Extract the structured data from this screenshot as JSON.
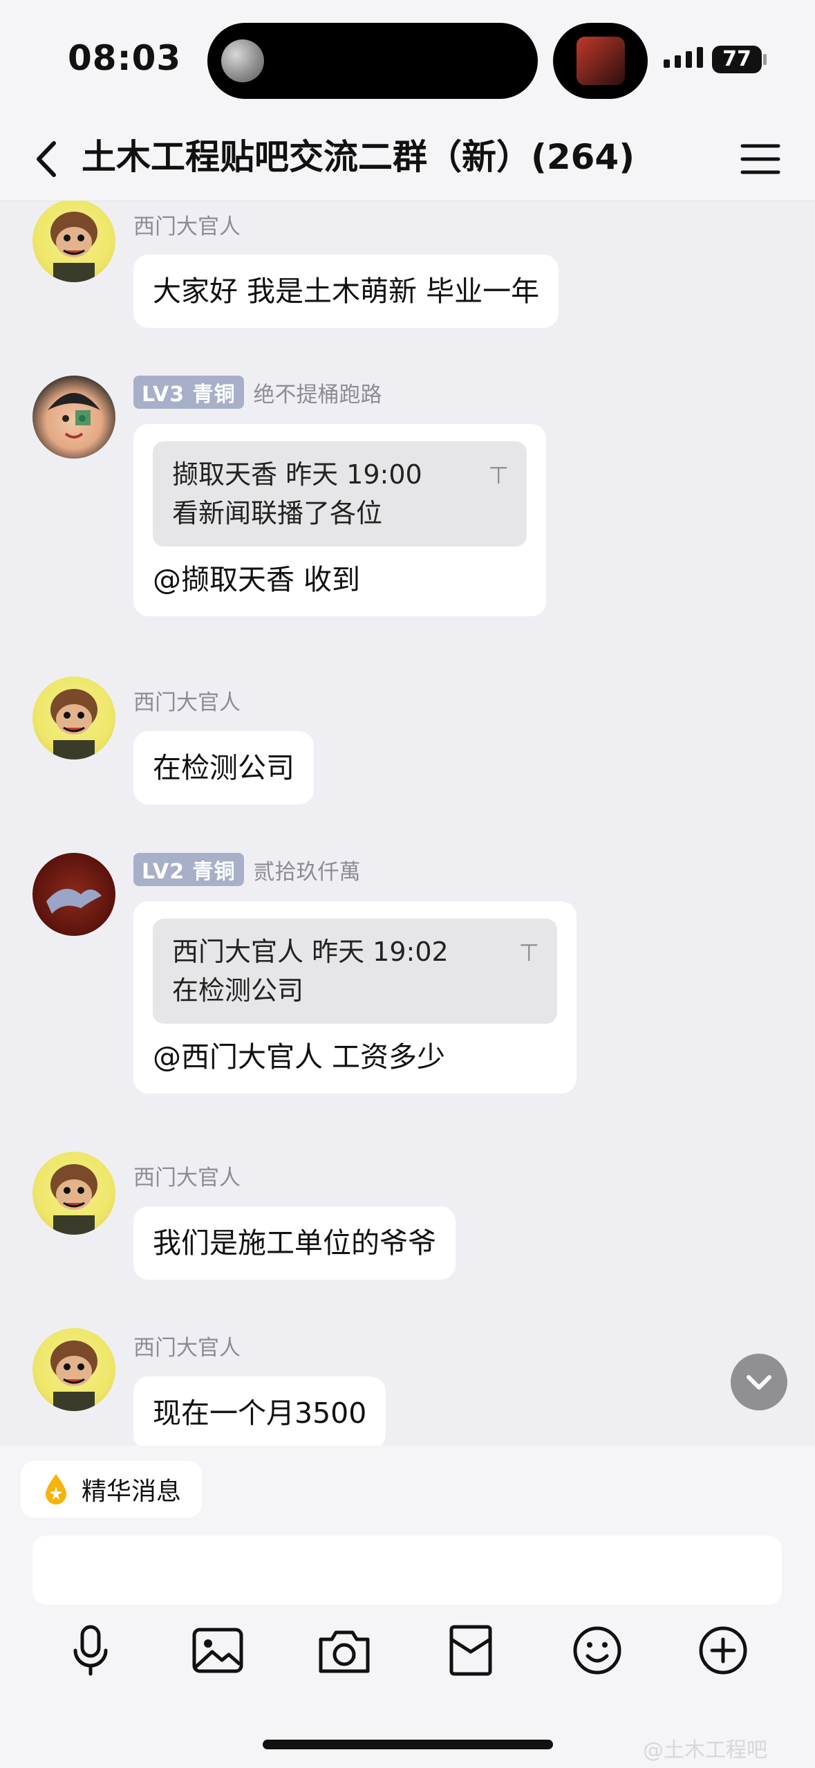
{
  "status_bar": {
    "time": "08:03",
    "battery": "77"
  },
  "nav": {
    "title": "土木工程贴吧交流二群（新）(264)"
  },
  "messages": [
    {
      "sender": "西门大官人",
      "text": "大家好 我是土木萌新 毕业一年"
    },
    {
      "level": "LV3",
      "rank": "青铜",
      "sender": "绝不提桶跑路",
      "quote": {
        "header": "撷取天香 昨天 19:00",
        "text": "看新闻联播了各位"
      },
      "text": "@撷取天香 收到"
    },
    {
      "sender": "西门大官人",
      "text": "在检测公司"
    },
    {
      "level": "LV2",
      "rank": "青铜",
      "sender": "贰拾玖仟萬",
      "quote": {
        "header": "西门大官人 昨天 19:02",
        "text": "在检测公司"
      },
      "text": "@西门大官人 工资多少"
    },
    {
      "sender": "西门大官人",
      "text": "我们是施工单位的爷爷"
    },
    {
      "sender": "西门大官人",
      "text": "现在一个月3500"
    }
  ],
  "bottom": {
    "essence_label": "精华消息",
    "input_placeholder": "",
    "tools": [
      "mic-icon",
      "image-icon",
      "camera-icon",
      "file-icon",
      "emoji-icon",
      "plus-icon"
    ]
  },
  "watermark": "@土木工程吧",
  "colors": {
    "background": "#efeff3",
    "bubble": "#ffffff",
    "quote": "#e6e6e8",
    "level_badge": "#a7b0c8",
    "essence_icon": "#f5b40c"
  }
}
